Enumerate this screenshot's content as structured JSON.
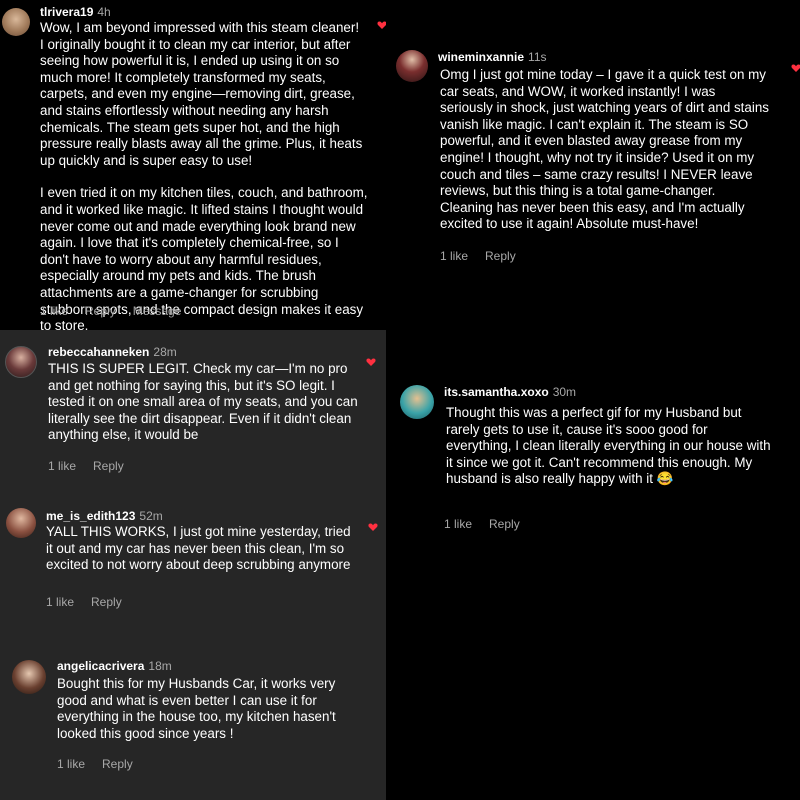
{
  "colors": {
    "heart": "#ff3040",
    "muted": "#a8a8a8",
    "panel_gray": "#262626",
    "background": "#000000"
  },
  "comments": [
    {
      "username": "tlrivera19",
      "time": "4h",
      "paragraphs": [
        "Wow, I am beyond impressed with this steam cleaner!\n I originally bought it to clean my car interior, but after seeing how powerful it is, I ended up using it on so much more! It completely transformed my seats, carpets, and even my engine—removing dirt, grease, and stains effortlessly without needing any harsh chemicals. The steam gets super hot, and the high pressure really blasts away all the grime. Plus, it heats up quickly and is super easy to use!",
        "I even tried it on my kitchen tiles, couch, and bathroom, and it worked like magic. It lifted stains I thought would never come out and made everything look brand new again. I love that it's completely chemical-free, so I don't have to worry about any harmful residues, especially around my pets and kids. The brush attachments are a game-changer for scrubbing stubborn spots, and the compact design makes it easy to store."
      ],
      "likes": "1 like",
      "reply": "Reply",
      "message": "Message"
    },
    {
      "username": "wineminxannie",
      "time": "11s",
      "paragraphs": [
        "Omg I just got mine today – I gave it a quick test on my car seats, and WOW, it worked instantly!  I was seriously in shock, just watching years of dirt and stains vanish like magic. I can't explain it. The steam is SO powerful, and it even blasted away grease from my engine! I thought, why not try it inside? Used it on my couch and tiles – same crazy results! I NEVER leave reviews, but this thing is a total game-changer. Cleaning has never been this easy, and I'm actually excited to use it again! Absolute must-have!"
      ],
      "likes": "1 like",
      "reply": "Reply"
    },
    {
      "username": "rebeccahanneken",
      "time": "28m",
      "paragraphs": [
        "THIS IS SUPER LEGIT. Check my car—I'm no pro and get nothing for saying this, but it's SO legit. I tested it on one small area of my seats, and you can literally see the dirt disappear. Even if it didn't clean anything else, it would be"
      ],
      "likes": "1 like",
      "reply": "Reply"
    },
    {
      "username": "its.samantha.xoxo",
      "time": "30m",
      "paragraphs": [
        "Thought this was a perfect gif for my Husband but rarely gets to use it, cause it's sooo good for everything, I clean literally everything in our house with it since we got it. Can't recommend this enough. My husband is also really happy with it 😂"
      ],
      "likes": "1 like",
      "reply": "Reply"
    },
    {
      "username": "me_is_edith123",
      "time": "52m",
      "paragraphs": [
        "YALL THIS WORKS, I just got mine yesterday, tried it out and my car has never been this clean, I'm so excited to not worry about deep scrubbing anymore"
      ],
      "likes": "1 like",
      "reply": "Reply"
    },
    {
      "username": "angelicacrivera",
      "time": "18m",
      "paragraphs": [
        "Bought this for my Husbands Car, it works very good and what is even better I can use it for everything in the house too, my kitchen hasen't looked this good since years !"
      ],
      "likes": "1 like",
      "reply": "Reply"
    }
  ]
}
